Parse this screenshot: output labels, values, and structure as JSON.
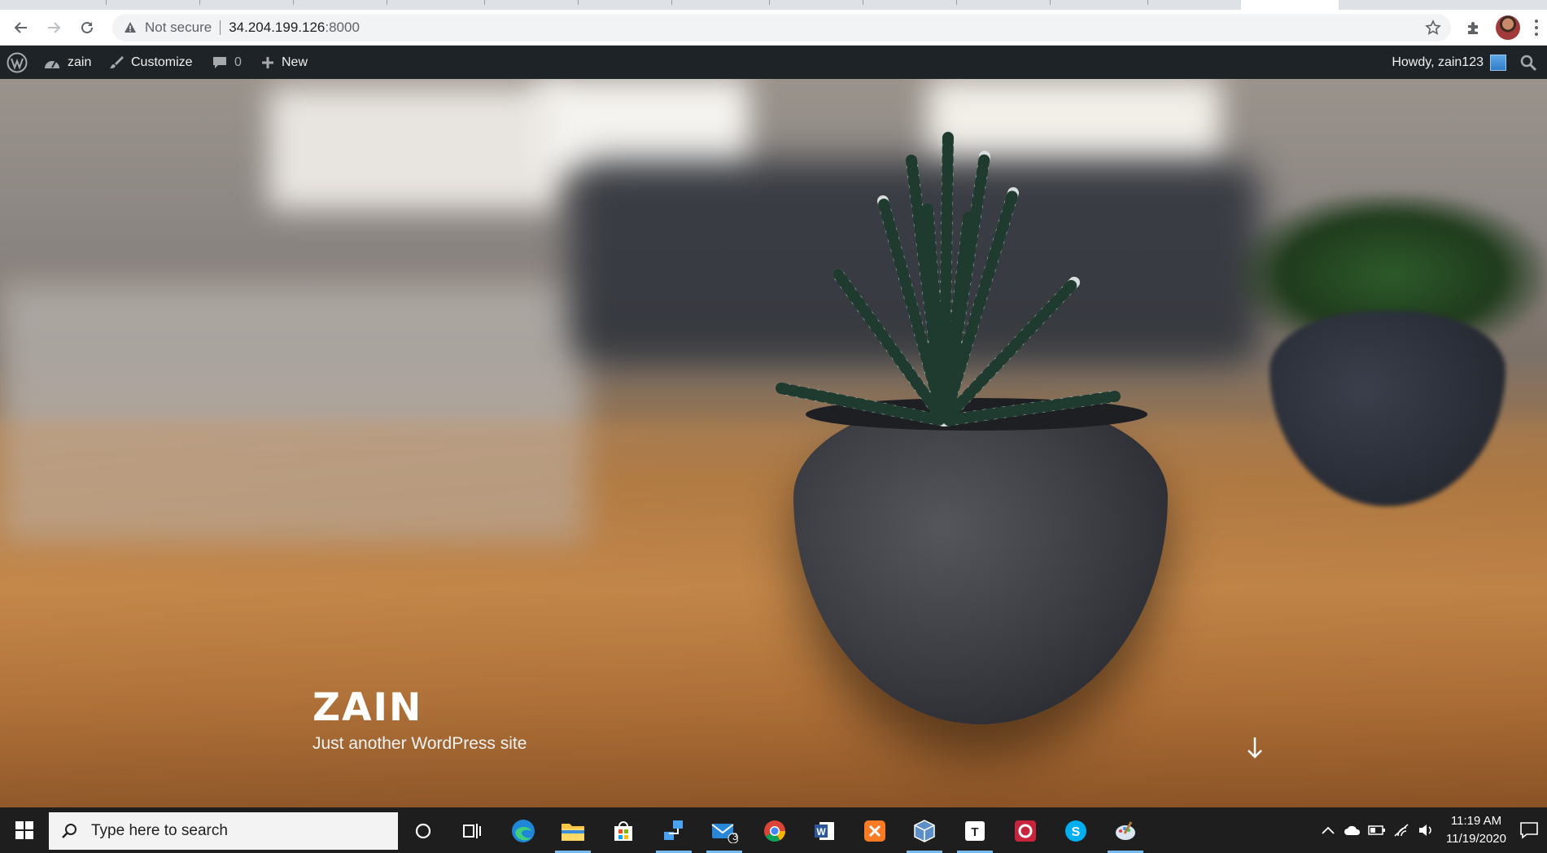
{
  "browser": {
    "security_label": "Not secure",
    "url_host": "34.204.199.126",
    "url_port": ":8000"
  },
  "adminbar": {
    "site_name": "zain",
    "customize": "Customize",
    "comments_count": "0",
    "new_label": "New",
    "howdy": "Howdy, zain123"
  },
  "hero": {
    "site_title": "ZAIN",
    "tagline": "Just another WordPress site"
  },
  "taskbar": {
    "search_placeholder": "Type here to search",
    "mail_badge": "3",
    "time": "11:19 AM",
    "date": "11/19/2020"
  },
  "colors": {
    "adminbar_bg": "#1d2327",
    "taskbar_bg": "#1e1e1e",
    "accent": "#76b9ed"
  }
}
